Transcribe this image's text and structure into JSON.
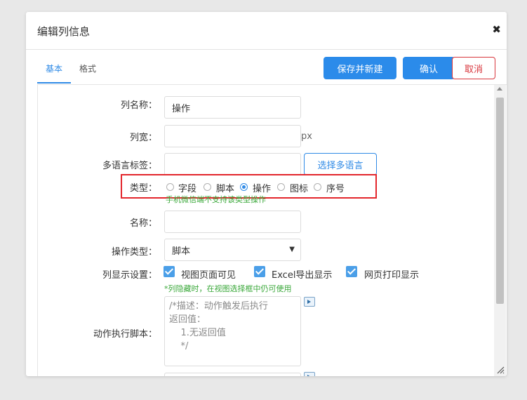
{
  "dialog": {
    "title": "编辑列信息",
    "close_icon": "close-icon",
    "close_glyph": "✖"
  },
  "tabs": [
    {
      "label": "基本",
      "active": true
    },
    {
      "label": "格式",
      "active": false
    }
  ],
  "actions": {
    "save_new": "保存并新建",
    "confirm": "确认",
    "cancel": "取消"
  },
  "form": {
    "column_name": {
      "label": "列名称：",
      "value": "操作"
    },
    "column_width": {
      "label": "列宽：",
      "value": "",
      "suffix": "px"
    },
    "multilang": {
      "label": "多语言标签：",
      "value": "",
      "button": "选择多语言"
    },
    "type": {
      "label": "类型：",
      "options": [
        "字段",
        "脚本",
        "操作",
        "图标",
        "序号"
      ],
      "selected": "操作",
      "hint": "手机微信端不支持该类型操作"
    },
    "name": {
      "label": "名称：",
      "value": ""
    },
    "action_type": {
      "label": "操作类型：",
      "value": "脚本",
      "arrow": "▼"
    },
    "display": {
      "label": "列显示设置：",
      "options": [
        {
          "label": "视图页面可见",
          "checked": true
        },
        {
          "label": "Excel导出显示",
          "checked": true
        },
        {
          "label": "网页打印显示",
          "checked": true
        }
      ],
      "hint": "*列隐藏时，在视图选择框中仍可使用"
    },
    "script": {
      "label": "动作执行脚本：",
      "value": "/*描述：动作触发后执行\n返回值：\n    1.无返回值\n    */"
    }
  },
  "colors": {
    "primary": "#2b8bea",
    "danger": "#d8363d",
    "hint": "#3aa83a",
    "highlight_box": "#e3262c"
  }
}
